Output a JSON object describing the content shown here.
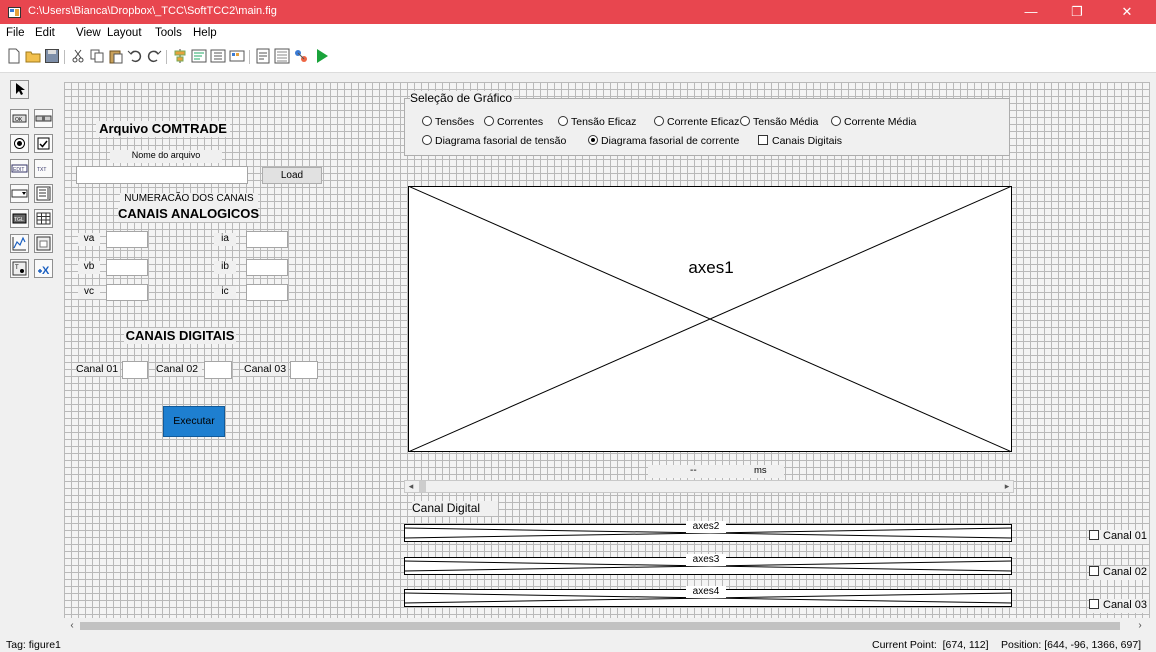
{
  "window": {
    "title": "C:\\Users\\Bianca\\Dropbox\\_TCC\\SoftTCC2\\main.fig",
    "minimize_glyph": "—",
    "restore_glyph": "❐",
    "close_glyph": "✕",
    "titlebar_color": "#e8464f"
  },
  "menu": [
    "File",
    "Edit",
    "View",
    "Layout",
    "Tools",
    "Help"
  ],
  "toolbar_icons": [
    "new-file-icon",
    "open-folder-icon",
    "save-icon",
    "cut-icon",
    "copy-icon",
    "paste-icon",
    "undo-icon",
    "redo-icon",
    "align-icon",
    "menu-editor-icon",
    "tab-order-icon",
    "toolbar-editor-icon",
    "editor-icon",
    "property-inspector-icon",
    "object-browser-icon",
    "run-icon"
  ],
  "palette_icons": [
    "select-tool-icon",
    "push-button-icon",
    "slider-icon",
    "radio-button-icon",
    "checkbox-icon",
    "edit-text-icon",
    "static-text-icon",
    "popup-menu-icon",
    "listbox-icon",
    "toggle-button-icon",
    "table-icon",
    "axes-icon",
    "panel-icon",
    "button-group-icon",
    "activex-icon"
  ],
  "gui": {
    "arquivo_title": "Arquivo COMTRADE",
    "nome_label": "Nome do arquivo",
    "load_button": "Load",
    "numeracao_label": "NUMERACÃO DOS CANAIS",
    "analog_title": "CANAIS ANALOGICOS",
    "analog_labels": [
      "va",
      "vb",
      "vc",
      "ia",
      "ib",
      "ic"
    ],
    "digital_title": "CANAIS DIGITAIS",
    "digital_labels": [
      "Canal 01",
      "Canal 02",
      "Canal 03"
    ],
    "executar_button": "Executar",
    "executar_color": "#1e7fd0",
    "selecao_title": "Seleção de Gráfico",
    "radio_row1": [
      "Tensões",
      "Correntes",
      "Tensão Eficaz",
      "Corrente Eficaz",
      "Tensão Média",
      "Corrente Média"
    ],
    "radio_row2": [
      "Diagrama fasorial de tensão",
      "Diagrama fasorial de corrente"
    ],
    "selected_radio": "Diagrama fasorial de corrente",
    "canais_digitais_checkbox": "Canais Digitais",
    "axes1_label": "axes1",
    "time_dash": "--",
    "time_unit": "ms",
    "canal_digital_label": "Canal Digital",
    "small_axes": [
      "axes2",
      "axes3",
      "axes4"
    ],
    "right_checkboxes": [
      "Canal 01",
      "Canal 02",
      "Canal 03"
    ]
  },
  "status": {
    "tag": "Tag: figure1",
    "current_point": "Current Point:  [674, 112]",
    "position": "Position: [644, -96, 1366, 697]"
  }
}
